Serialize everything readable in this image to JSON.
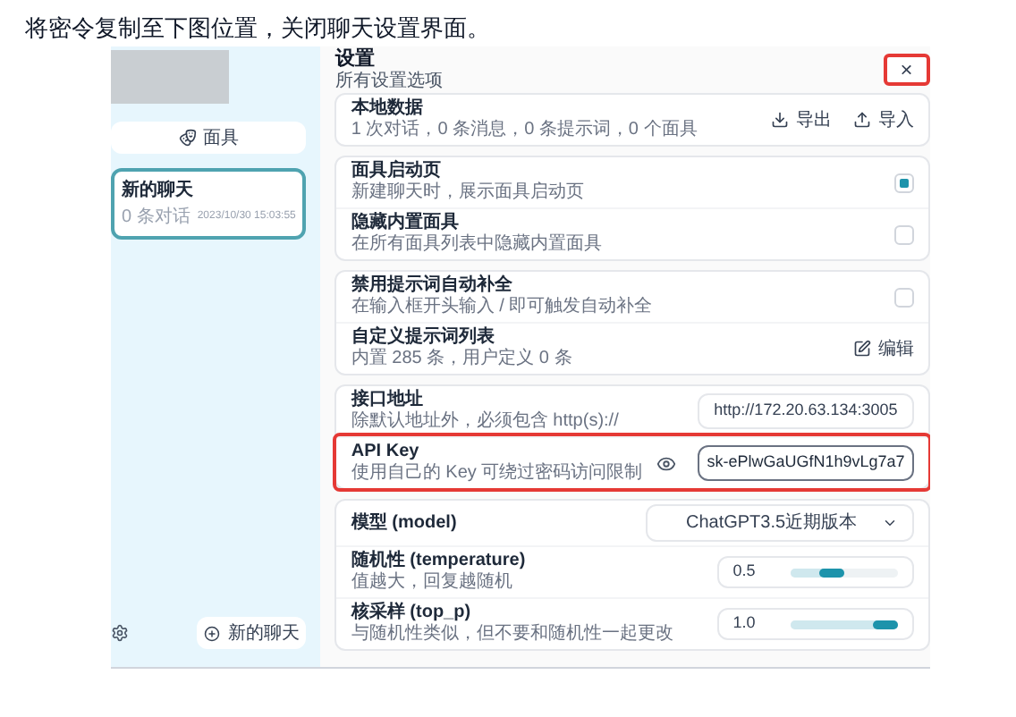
{
  "instruction": "将密令复制至下图位置，关闭聊天设置界面。",
  "sidebar": {
    "mask_button": "面具",
    "chats": [
      {
        "title": "新的聊天",
        "count": "0 条对话",
        "time": "2023/10/30 15:03:55",
        "selected": true
      }
    ],
    "new_chat_button": "新的聊天"
  },
  "settings": {
    "title": "设置",
    "subtitle": "所有设置选项",
    "close": {
      "label": "×",
      "highlighted": true
    },
    "groups": [
      {
        "items": [
          {
            "kind": "actions",
            "title": "本地数据",
            "desc": "1 次对话，0 条消息，0 条提示词，0 个面具",
            "actions": [
              "导出",
              "导入"
            ]
          }
        ]
      },
      {
        "items": [
          {
            "kind": "checkbox",
            "title": "面具启动页",
            "desc": "新建聊天时，展示面具启动页",
            "checked": true
          },
          {
            "kind": "checkbox",
            "title": "隐藏内置面具",
            "desc": "在所有面具列表中隐藏内置面具",
            "checked": false
          }
        ]
      },
      {
        "items": [
          {
            "kind": "checkbox",
            "title": "禁用提示词自动补全",
            "desc": "在输入框开头输入 / 即可触发自动补全",
            "checked": false
          },
          {
            "kind": "button",
            "title": "自定义提示词列表",
            "desc": "内置 285 条，用户定义 0 条",
            "button": "编辑"
          }
        ]
      },
      {
        "items": [
          {
            "kind": "input",
            "title": "接口地址",
            "desc": "除默认地址外，必须包含 http(s)://",
            "value": "http://172.20.63.134:3005"
          },
          {
            "kind": "password",
            "title": "API Key",
            "desc": "使用自己的 Key 可绕过密码访问限制",
            "value": "sk-ePlwGaUGfN1h9vLg7a7",
            "highlighted": true
          }
        ]
      },
      {
        "items": [
          {
            "kind": "select",
            "title": "模型 (model)",
            "value": "ChatGPT3.5近期版本"
          },
          {
            "kind": "slider",
            "title": "随机性 (temperature)",
            "desc": "值越大，回复越随机",
            "value": "0.5",
            "level": 0.5
          },
          {
            "kind": "slider",
            "title": "核采样 (top_p)",
            "desc": "与随机性类似，但不要和随机性一起更改",
            "value": "1.0",
            "level": 1
          }
        ]
      }
    ]
  }
}
